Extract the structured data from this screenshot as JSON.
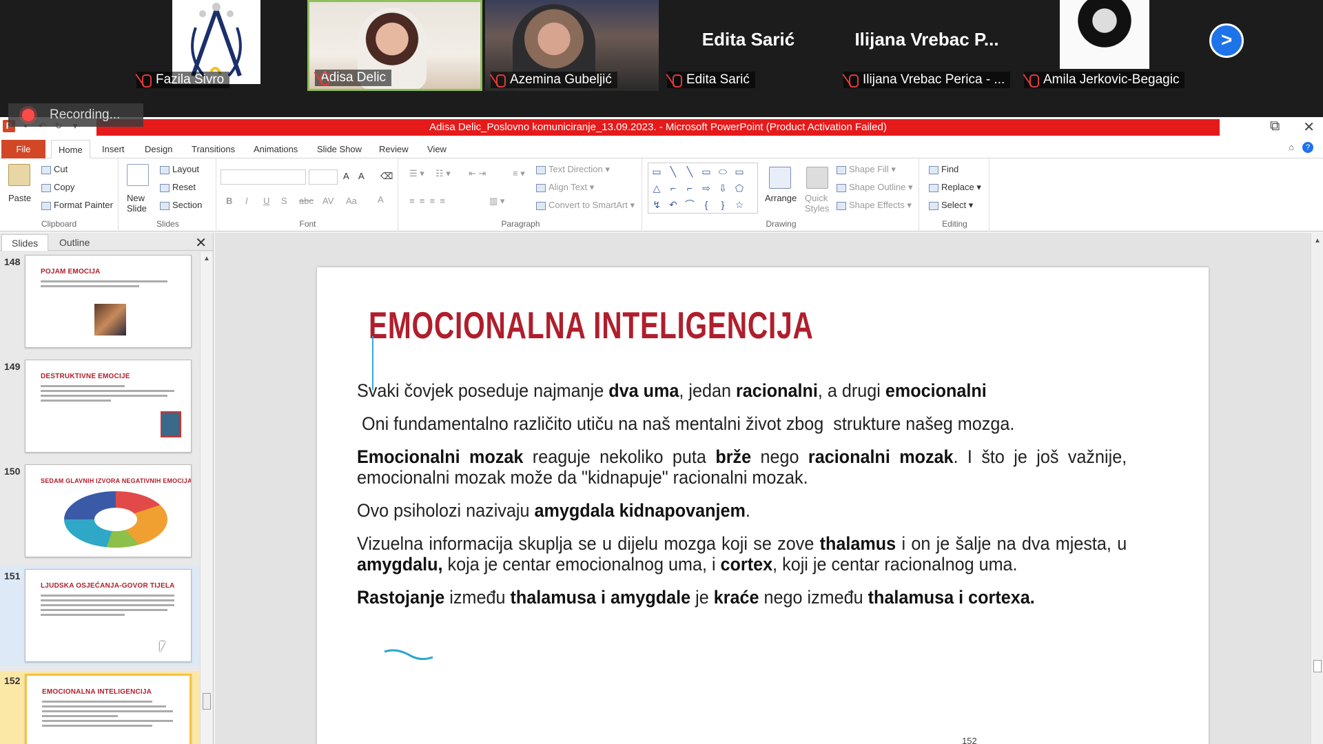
{
  "meeting": {
    "participants": [
      {
        "name": "Fazila Sivro",
        "muted": true
      },
      {
        "name": "Adisa Delic",
        "muted": false,
        "active": true
      },
      {
        "name": "Azemina Gubeljić",
        "muted": true
      },
      {
        "name": "Edita Sarić",
        "muted": true,
        "display": "Edita Sarić"
      },
      {
        "name": "Ilijana Vrebac Perica - ...",
        "muted": true,
        "display": "Ilijana Vrebac P..."
      },
      {
        "name": "Amila Jerkovic-Begagic",
        "muted": true
      }
    ],
    "next_label": ">",
    "recording_label": "Recording..."
  },
  "window": {
    "title": "Adisa Delic_Poslovno komuniciranje_13.09.2023. - Microsoft PowerPoint (Product Activation Failed)",
    "controls": {
      "restore": "⧉",
      "close": "✕"
    }
  },
  "tabs": [
    "File",
    "Home",
    "Insert",
    "Design",
    "Transitions",
    "Animations",
    "Slide Show",
    "Review",
    "View"
  ],
  "ribbon": {
    "clipboard": {
      "paste": "Paste",
      "cut": "Cut",
      "copy": "Copy",
      "format_painter": "Format Painter",
      "label": "Clipboard"
    },
    "slides": {
      "new_slide": "New Slide",
      "layout": "Layout",
      "reset": "Reset",
      "section": "Section",
      "label": "Slides"
    },
    "font": {
      "label": "Font",
      "bold": "B",
      "italic": "I",
      "underline": "U",
      "strike": "S",
      "abc": "abc",
      "av": "AV",
      "aa": "Aa",
      "a": "A"
    },
    "paragraph": {
      "text_direction": "Text Direction",
      "align_text": "Align Text",
      "convert": "Convert to SmartArt",
      "label": "Paragraph"
    },
    "drawing": {
      "arrange": "Arrange",
      "quick_styles": "Quick Styles",
      "shape_fill": "Shape Fill",
      "shape_outline": "Shape Outline",
      "shape_effects": "Shape Effects",
      "label": "Drawing",
      "shapes": [
        "▭",
        "╲",
        "╲",
        "▭",
        "⬭",
        "▭",
        "△",
        "⌐",
        "⌐",
        "⇨",
        "⇩",
        "⬠",
        "↯",
        "↶",
        "⌒",
        "{",
        "}",
        "☆"
      ]
    },
    "editing": {
      "find": "Find",
      "replace": "Replace",
      "select": "Select",
      "label": "Editing"
    }
  },
  "pane": {
    "tab_slides": "Slides",
    "tab_outline": "Outline",
    "close": "✕"
  },
  "thumbnails": [
    {
      "num": "148",
      "title": "POJAM EMOCIJA"
    },
    {
      "num": "149",
      "title": "DESTRUKTIVNE EMOCIJE"
    },
    {
      "num": "150",
      "title": "SEDAM GLAVNIH IZVORA NEGATIVNIH EMOCIJA"
    },
    {
      "num": "151",
      "title": "LJUDSKA OSJEĆANJA-GOVOR TIJELA"
    },
    {
      "num": "152",
      "title": "EMOCIONALNA INTELIGENCIJA"
    }
  ],
  "slide": {
    "title": "EMOCIONALNA INTELIGENCIJA",
    "number": "152",
    "p1": {
      "a": "Svaki čovjek poseduje najmanje ",
      "b": "dva uma",
      "c": ", jedan ",
      "d": "racionalni",
      "e": ", a drugi ",
      "f": "emocionalni"
    },
    "p2": " Oni fundamentalno različito utiču na naš mentalni život zbog  strukture našeg mozga.",
    "p3": {
      "a": "Emocionalni mozak",
      "b": " reaguje nekoliko puta ",
      "c": "brže",
      "d": " nego ",
      "e": "racionalni mozak",
      "f": ". I što je još važnije, emocionalni mozak može da \"kidnapuje\" racionalni mozak."
    },
    "p4": {
      "a": "Ovo psiholozi nazivaju ",
      "b": "amygdala kidnapovanjem",
      "c": "."
    },
    "p5": {
      "a": "Vizuelna informacija skuplja se u dijelu mozga koji se zove ",
      "b": "thalamus",
      "c": " i on je šalje na dva mjesta, u ",
      "d": "amygdalu,",
      "e": " koja je centar emocionalnog uma, i ",
      "f": "cortex",
      "g": ", koji je centar racionalnog uma."
    },
    "p6": {
      "a": "Rastojanje",
      "b": " između ",
      "c": "thalamusa i amygdale",
      "d": " je ",
      "e": "kraće",
      "f": " nego između ",
      "g": "thalamusa i cortexa."
    }
  },
  "colors": {
    "title_red": "#b01e2c",
    "titlebar_red": "#e51b1b",
    "file_tab": "#d24726",
    "accent_blue": "#1e73e8"
  }
}
